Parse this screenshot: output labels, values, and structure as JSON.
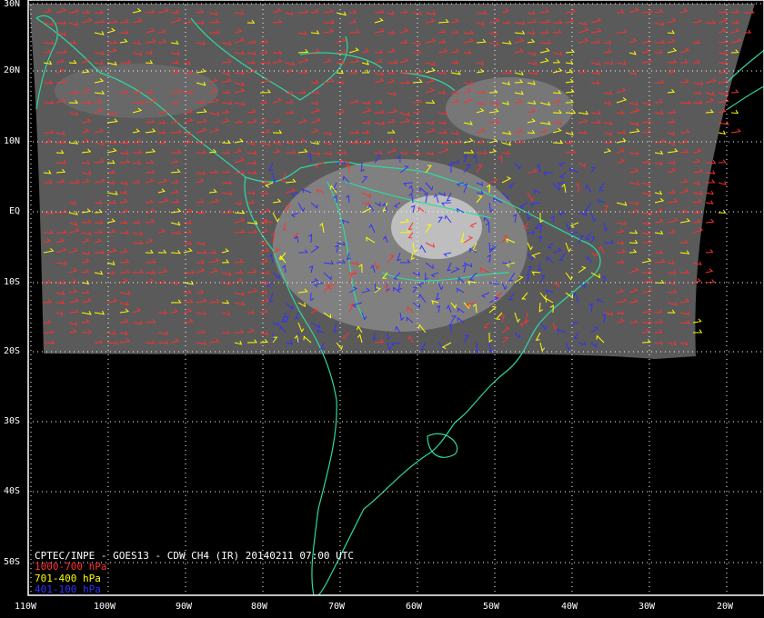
{
  "caption": {
    "title": "CPTEC/INPE - GOES13 - CDW CH4 (IR) 20140211 07:00 UTC",
    "legend": [
      {
        "label": "1000-700 hPa",
        "color": "#ff3030"
      },
      {
        "label": "701-400 hPa",
        "color": "#ffff00"
      },
      {
        "label": "401-100 hPa",
        "color": "#3030ff"
      }
    ]
  },
  "axes": {
    "lat_labels": [
      "30N",
      "20N",
      "10N",
      "EQ",
      "10S",
      "20S",
      "30S",
      "40S",
      "50S"
    ],
    "lon_labels": [
      "110W",
      "100W",
      "90W",
      "80W",
      "70W",
      "60W",
      "50W",
      "40W",
      "30W",
      "20W"
    ]
  },
  "colors": {
    "coastline": "#2fd9a0",
    "grid": "#ffffff",
    "frame": "#ffffff",
    "background": "#000000",
    "ir_image": "#555555"
  }
}
